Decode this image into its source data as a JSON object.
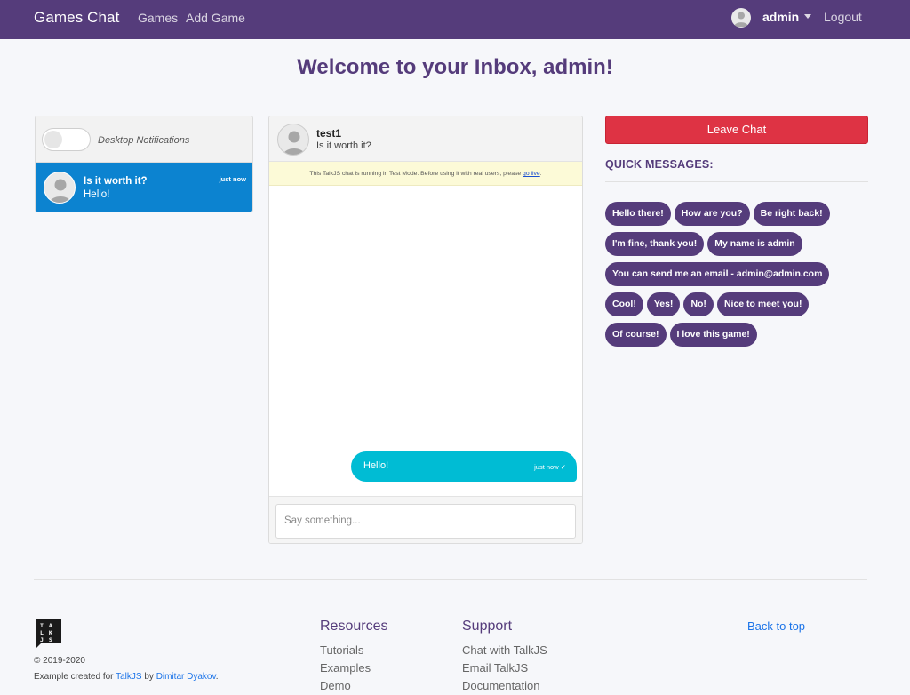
{
  "navbar": {
    "brand": "Games Chat",
    "links": [
      "Games",
      "Add Game"
    ],
    "user": "admin",
    "logout": "Logout"
  },
  "page": {
    "welcome": "Welcome to your Inbox, admin!"
  },
  "inbox": {
    "notifications_label": "Desktop Notifications",
    "notifications_enabled": false,
    "conversation": {
      "subject": "Is it worth it?",
      "last_message": "Hello!",
      "time": "just now"
    }
  },
  "chat": {
    "participant": "test1",
    "subject": "Is it worth it?",
    "test_mode_text": "This TalkJS chat is running in Test Mode. Before using it with real users, please",
    "go_live": "go live",
    "message": {
      "text": "Hello!",
      "time": "just now ✓"
    },
    "compose_placeholder": "Say something..."
  },
  "actions": {
    "leave_chat": "Leave Chat",
    "quick_messages_title": "QUICK MESSAGES:",
    "quick_messages": [
      "Hello there!",
      "How are you?",
      "Be right back!",
      "I'm fine, thank you!",
      "My name is admin",
      "You can send me an email - admin@admin.com",
      "Cool!",
      "Yes!",
      "No!",
      "Nice to meet you!",
      "Of course!",
      "I love this game!"
    ]
  },
  "footer": {
    "logo_text": "TALK\nJS",
    "copyright": "© 2019-2020",
    "credit_prefix": "Example created for",
    "credit_link1": "TalkJS",
    "credit_by": "by",
    "credit_link2": "Dimitar Dyakov",
    "credit_suffix": ".",
    "resources_title": "Resources",
    "resources": [
      "Tutorials",
      "Examples",
      "Demo"
    ],
    "support_title": "Support",
    "support": [
      "Chat with TalkJS",
      "Email TalkJS",
      "Documentation"
    ],
    "back_to_top": "Back to top"
  },
  "colors": {
    "brand": "#553c7b",
    "danger": "#de3344",
    "active_conversation": "#0c83d0",
    "own_message": "#00bcd4"
  }
}
